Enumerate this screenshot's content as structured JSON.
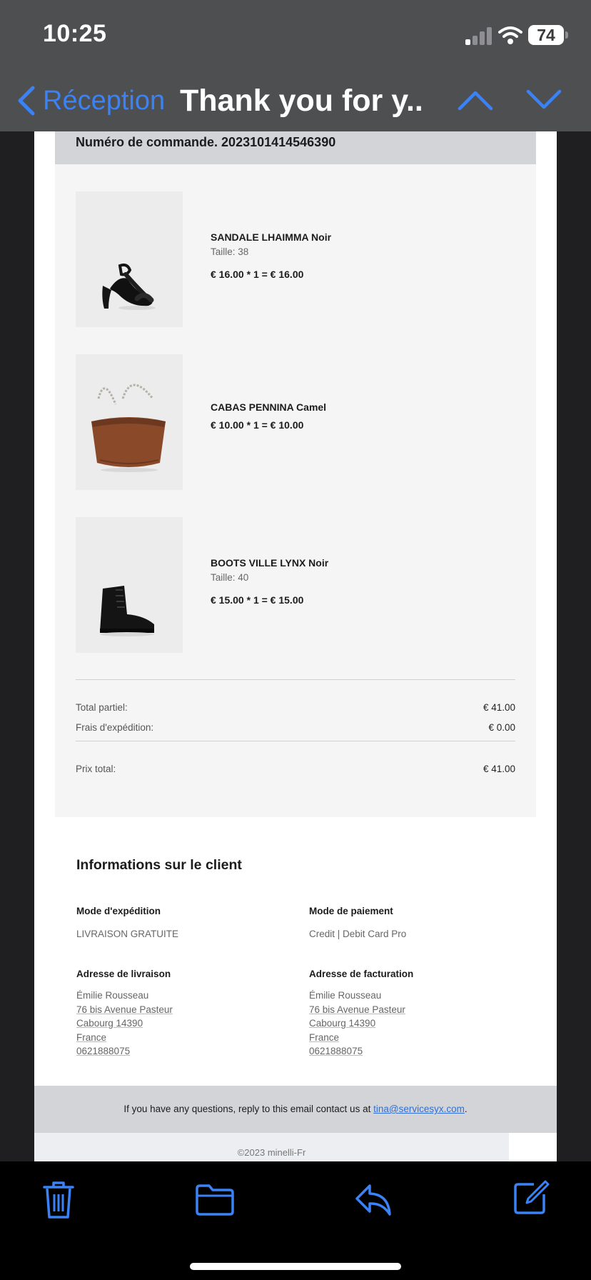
{
  "status_bar": {
    "time": "10:25",
    "battery": "74"
  },
  "nav": {
    "back_label": "Réception",
    "title": "Thank you for y..."
  },
  "order": {
    "number_line": "Numéro de commande. 2023101414546390",
    "items": [
      {
        "name": "SANDALE LHAIMMA Noir",
        "size": "Taille: 38",
        "price_line": "€ 16.00 * 1 = € 16.00",
        "image": "black-heeled-sandal"
      },
      {
        "name": "CABAS PENNINA Camel",
        "size": "",
        "price_line": "€ 10.00 * 1 = € 10.00",
        "image": "camel-tote-bag"
      },
      {
        "name": "BOOTS VILLE LYNX Noir",
        "size": "Taille: 40",
        "price_line": "€ 15.00 * 1 = € 15.00",
        "image": "black-ankle-boot"
      }
    ],
    "totals": {
      "subtotal_label": "Total partiel:",
      "subtotal": "€ 41.00",
      "shipping_label": "Frais d'expédition:",
      "shipping": "€ 0.00",
      "total_label": "Prix total:",
      "total": "€ 41.00"
    }
  },
  "client": {
    "title": "Informations sur le client",
    "shipping_mode_label": "Mode d'expédition",
    "shipping_mode": "LIVRAISON GRATUITE",
    "payment_mode_label": "Mode de paiement",
    "payment_mode": "Credit | Debit Card Pro",
    "delivery_address_label": "Adresse de livraison",
    "delivery_address": [
      "Émilie Rousseau",
      "76 bis Avenue Pasteur",
      "Cabourg 14390",
      "France",
      "0621888075"
    ],
    "billing_address_label": "Adresse de facturation",
    "billing_address": [
      "Émilie Rousseau",
      "76 bis Avenue Pasteur",
      "Cabourg 14390",
      "France",
      "0621888075"
    ]
  },
  "footer": {
    "contact_text": "If you have any questions, reply to this email contact us at",
    "contact_email": "tina@servicesyx.com",
    "contact_end": ".",
    "copyright": "©2023 minelli-Fr"
  },
  "toolbar": {
    "icons": [
      "trash-icon",
      "folder-icon",
      "reply-icon",
      "compose-icon"
    ]
  },
  "colors": {
    "accent": "#3b82f6",
    "nav_bg": "#4e4f51",
    "panel_bg": "#f5f5f5",
    "header_bg": "#d3d4d7",
    "link": "#2f6fd6"
  }
}
